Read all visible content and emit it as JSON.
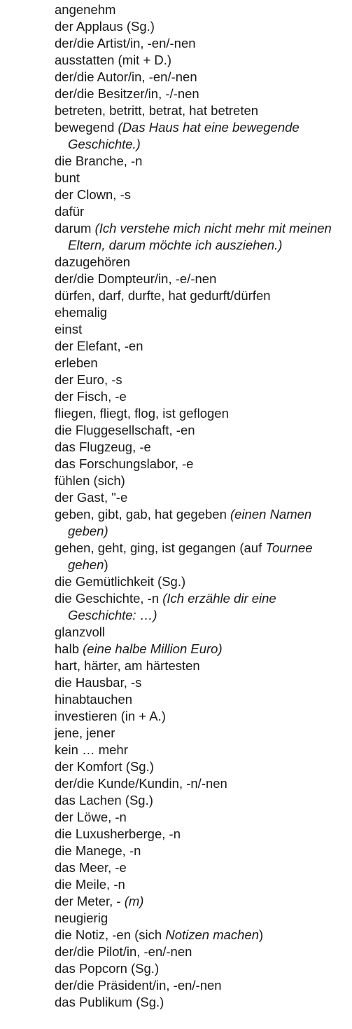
{
  "entries": [
    {
      "text": "angenehm"
    },
    {
      "text": "der Applaus (Sg.)"
    },
    {
      "text": "der/die Artist/in, -en/-nen"
    },
    {
      "text": "ausstatten (mit + D.)"
    },
    {
      "text": "der/die Autor/in, -en/-nen"
    },
    {
      "text": "der/die Besitzer/in, -/-nen"
    },
    {
      "text": "betreten, betritt, betrat, hat betreten"
    },
    {
      "text": "bewegend ",
      "example": "(Das Haus hat eine bewegende Geschichte.)"
    },
    {
      "text": "die Branche, -n"
    },
    {
      "text": "bunt"
    },
    {
      "text": "der Clown, -s"
    },
    {
      "text": "dafür"
    },
    {
      "text": "darum ",
      "example": "(Ich verstehe mich nicht mehr mit meinen Eltern, darum möchte ich ausziehen.)"
    },
    {
      "text": "dazugehören"
    },
    {
      "text": "der/die Dompteur/in, -e/-nen"
    },
    {
      "text": "dürfen, darf, durfte, hat gedurft/dürfen"
    },
    {
      "text": "ehemalig"
    },
    {
      "text": "einst"
    },
    {
      "text": "der Elefant, -en"
    },
    {
      "text": "erleben"
    },
    {
      "text": "der Euro, -s"
    },
    {
      "text": "der Fisch, -e"
    },
    {
      "text": "fliegen, fliegt, flog, ist geflogen"
    },
    {
      "text": "die Fluggesellschaft, -en"
    },
    {
      "text": "das Flugzeug, -e"
    },
    {
      "text": "das Forschungslabor, -e"
    },
    {
      "text": "fühlen (sich)"
    },
    {
      "text": "der Gast, \"-e"
    },
    {
      "text": "geben, gibt, gab, hat gegeben ",
      "example": "(einen Namen geben)"
    },
    {
      "text": "gehen, geht, ging, ist gegangen (auf ",
      "example": "Tournee gehen",
      "suffix": ")"
    },
    {
      "text": "die Gemütlichkeit (Sg.)"
    },
    {
      "text": "die Geschichte, -n ",
      "example": "(Ich erzähle dir eine Geschichte: …)"
    },
    {
      "text": "glanzvoll"
    },
    {
      "text": "halb ",
      "example": "(eine halbe Million Euro)"
    },
    {
      "text": "hart, härter, am härtesten"
    },
    {
      "text": "die Hausbar, -s"
    },
    {
      "text": "hinabtauchen"
    },
    {
      "text": "investieren (in + A.)"
    },
    {
      "text": "jene, jener"
    },
    {
      "text": "kein … mehr"
    },
    {
      "text": "der Komfort (Sg.)"
    },
    {
      "text": "der/die Kunde/Kundin, -n/-nen"
    },
    {
      "text": "das Lachen (Sg.)"
    },
    {
      "text": "der Löwe, -n"
    },
    {
      "text": "die Luxusherberge, -n"
    },
    {
      "text": "die Manege, -n"
    },
    {
      "text": "das Meer, -e"
    },
    {
      "text": "die Meile, -n"
    },
    {
      "text": "der Meter, - ",
      "example": "(m)"
    },
    {
      "text": "neugierig"
    },
    {
      "text": "die Notiz, -en (sich ",
      "example": "Notizen machen",
      "suffix": ")"
    },
    {
      "text": "der/die Pilot/in, -en/-nen"
    },
    {
      "text": "das Popcorn (Sg.)"
    },
    {
      "text": "der/die Präsident/in, -en/-nen"
    },
    {
      "text": "das Publikum (Sg.)"
    }
  ]
}
